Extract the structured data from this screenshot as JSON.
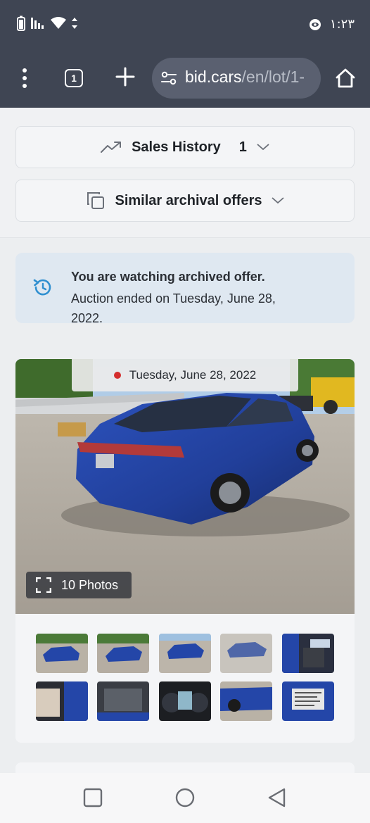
{
  "status_bar": {
    "time": "١:٢٣",
    "icons": [
      "battery-icon",
      "signal-icon",
      "wifi-icon",
      "data-arrows-icon",
      "eye-comfort-icon"
    ]
  },
  "browser": {
    "tab_count": "1",
    "url_host": "bid.cars",
    "url_path": "/en/lot/1-",
    "icons": [
      "menu-dots-icon",
      "tabs-icon",
      "new-tab-plus-icon",
      "site-settings-icon",
      "home-icon"
    ]
  },
  "sales_history": {
    "label": "Sales History",
    "count": "1",
    "icon": "trending-up-icon"
  },
  "similar_offers": {
    "label": "Similar archival offers",
    "icon": "copy-icon"
  },
  "notice": {
    "title": "You are watching archived offer.",
    "text": "Auction ended on Tuesday, June 28, 2022.",
    "icon": "history-icon"
  },
  "gallery": {
    "date": "Tuesday, June 28, 2022",
    "photos_label": "10 Photos",
    "thumbnail_count": 10
  },
  "colors": {
    "chrome": "#3f4553",
    "notice_bg": "#dfe8f1",
    "accent_blue": "#2f8fd0",
    "car_blue": "#2446a8"
  }
}
